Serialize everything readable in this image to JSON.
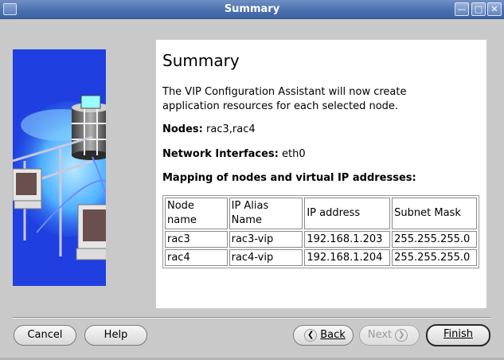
{
  "window": {
    "title": "Summary",
    "controls": [
      "minimize-icon",
      "maximize-icon",
      "close-icon"
    ]
  },
  "illustration": {
    "icon": "database-network-illustration"
  },
  "summary": {
    "heading": "Summary",
    "description": "The VIP Configuration Assistant will now create application resources for each selected node.",
    "nodes_label": "Nodes:",
    "nodes_value": "rac3,rac4",
    "interfaces_label": "Network Interfaces:",
    "interfaces_value": "eth0",
    "mapping_title": "Mapping of nodes and virtual IP addresses:"
  },
  "table": {
    "headers": [
      "Node name",
      "IP Alias Name",
      "IP address",
      "Subnet Mask"
    ],
    "rows": [
      [
        "rac3",
        "rac3-vip",
        "192.168.1.203",
        "255.255.255.0"
      ],
      [
        "rac4",
        "rac4-vip",
        "192.168.1.204",
        "255.255.255.0"
      ]
    ]
  },
  "buttons": {
    "cancel": "Cancel",
    "help": "Help",
    "back": "Back",
    "next": "Next",
    "finish": "Finish"
  },
  "colors": {
    "titlebar": "#4a6fae",
    "illustration_bg": "#1f3fe0",
    "window_bg": "#c9c9c9"
  }
}
